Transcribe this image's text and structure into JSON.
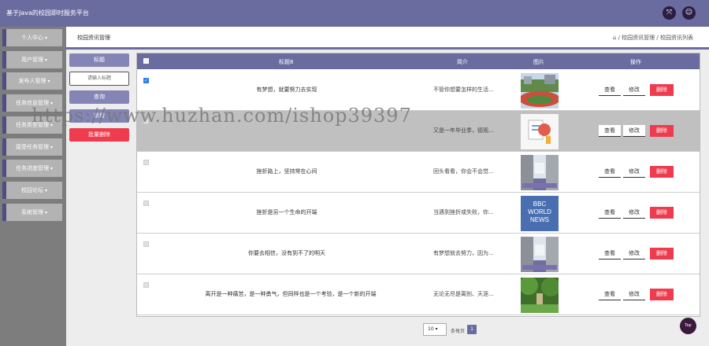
{
  "header": {
    "title": "基于Java的校园即时服务平台",
    "icons": [
      "fullscreen-icon",
      "user-icon"
    ]
  },
  "sidebar": {
    "items": [
      {
        "label": "个人中心"
      },
      {
        "label": "用户管理"
      },
      {
        "label": "发布人管理"
      },
      {
        "label": "任务信息管理"
      },
      {
        "label": "任务类型管理"
      },
      {
        "label": "接受任务管理"
      },
      {
        "label": "任务进度管理"
      },
      {
        "label": "校园论坛"
      },
      {
        "label": "系统管理"
      }
    ]
  },
  "breadcrumb": {
    "page_title": "校园资讯管理",
    "path": "/ 校园资讯管理 / 校园资讯列表"
  },
  "search": {
    "tab_label": "标题",
    "placeholder": "请输入标题",
    "query_label": "查询",
    "add_label": "新增",
    "batch_delete_label": "批量删除"
  },
  "table": {
    "headers": {
      "title": "标题8",
      "brief": "简介",
      "image": "图片",
      "actions": "操作"
    },
    "view_label": "查看",
    "edit_label": "修改",
    "delete_label": "删除",
    "rows": [
      {
        "title": "有梦想，就要努力去实现",
        "brief": "不管你想要怎样的生活...",
        "image": "campus-track"
      },
      {
        "title": "",
        "brief": "又是一年毕业季，德观...",
        "image": "illustration"
      },
      {
        "title": "挫折路上，坚持常在心间",
        "brief": "回头看看，你会不会觉...",
        "image": "library"
      },
      {
        "title": "挫折是另一个生命的开端",
        "brief": "当遇到挫折或失败，你...",
        "image": "bbc-news"
      },
      {
        "title": "你要去相信，没有到不了的明天",
        "brief": "有梦想就去努力，因为...",
        "image": "library"
      },
      {
        "title": "离开是一种痛苦，是一种勇气，但同样也是一个考验，是一个新的开端",
        "brief": "无论无尽是离别、天涯...",
        "image": "garden"
      }
    ],
    "bbc_text": [
      "BBC",
      "WORLD",
      "NEWS"
    ]
  },
  "pagination": {
    "page_size": "10",
    "page_size_label": "条每页",
    "current_page": "1"
  },
  "scroll_top_label": "Top",
  "watermark": "https://www.huzhan.com/ishop39397",
  "colors": {
    "header": "#6a6b9f",
    "sidebar": "#7d7d7d",
    "danger": "#ef3b4e",
    "accent": "#4d4e86"
  }
}
